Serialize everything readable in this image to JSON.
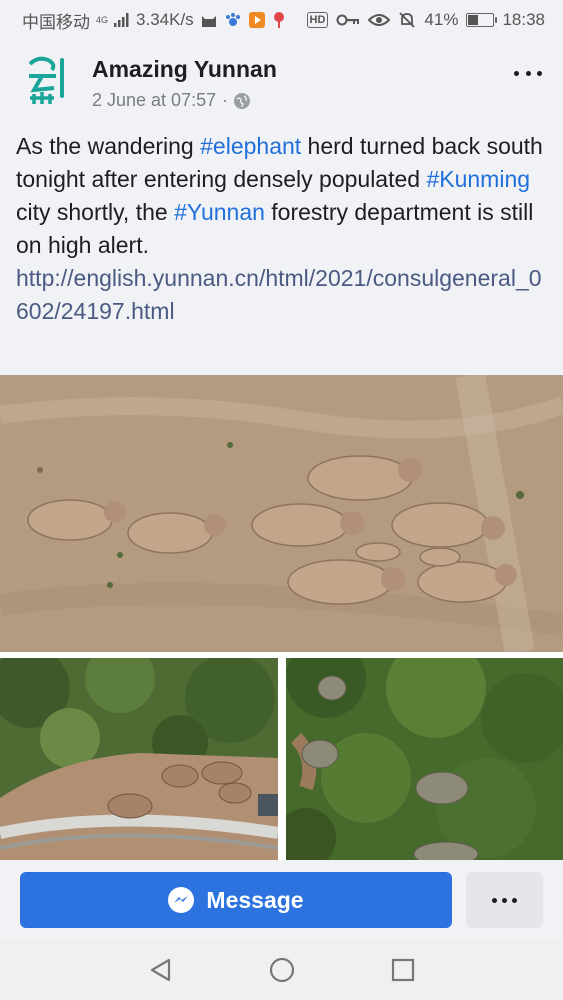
{
  "status_bar": {
    "carrier": "中国移动",
    "network_tag": "4G",
    "net_speed": "3.34K/s",
    "hd_label": "HD",
    "battery_text": "41%",
    "battery_level": 0.41,
    "time": "18:38"
  },
  "post": {
    "page_name": "Amazing Yunnan",
    "date": "2 June at 07:57",
    "meta_separator": "·",
    "text": {
      "t1": "As the wandering ",
      "tag1": "#elephant",
      "t2": " herd turned back south tonight after entering densely populated ",
      "tag2": "#Kunming",
      "t3": " city shortly, the ",
      "tag3": "#Yunnan",
      "t4": " forestry department is still on high alert."
    },
    "link": "http://english.yunnan.cn/html/2021/consulgeneral_0602/24197.html",
    "photo_count": 3
  },
  "actions": {
    "message_label": "Message"
  },
  "colors": {
    "brand_blue": "#2d73e0",
    "hashtag": "#216fdb",
    "link": "#4b5a82",
    "logo_teal": "#1aa59a"
  },
  "icons": {
    "message": "messenger-icon",
    "globe": "globe-icon",
    "nav_back": "triangle-back-icon",
    "nav_home": "circle-home-icon",
    "nav_recent": "square-recents-icon"
  }
}
